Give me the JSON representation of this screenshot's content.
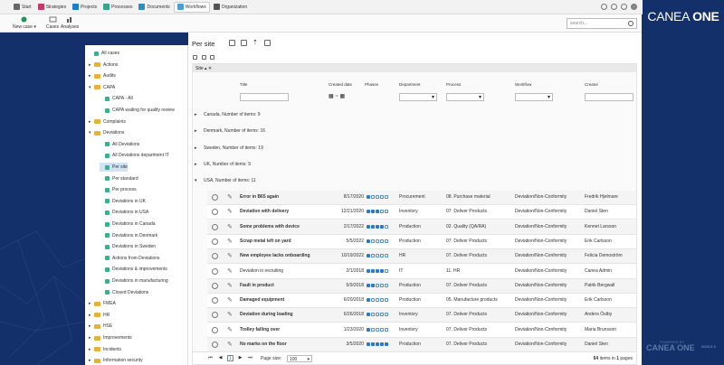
{
  "topnav": {
    "tabs": [
      {
        "label": "Start",
        "color": "#666666"
      },
      {
        "label": "Strategies",
        "color": "#c0396b"
      },
      {
        "label": "Projects",
        "color": "#1c7fc9"
      },
      {
        "label": "Processes",
        "color": "#37a58c"
      },
      {
        "label": "Documents",
        "color": "#2d8fc0"
      },
      {
        "label": "Workflows",
        "color": "#4b9fd1"
      },
      {
        "label": "Organization",
        "color": "#555555"
      }
    ],
    "active": "Workflows"
  },
  "toolbar": {
    "new_case": "New case",
    "cases": "Cases",
    "analyses": "Analyses"
  },
  "search": {
    "placeholder": "search..."
  },
  "brand": {
    "text_a": "CANEA",
    "text_b": "ONE"
  },
  "sidebar": {
    "items": [
      {
        "label": "All cases",
        "type": "view",
        "level": 1,
        "arrow": ""
      },
      {
        "label": "Actions",
        "type": "folder",
        "level": 1,
        "arrow": "▸"
      },
      {
        "label": "Audits",
        "type": "folder",
        "level": 1,
        "arrow": "▸"
      },
      {
        "label": "CAPA",
        "type": "folder",
        "level": 1,
        "arrow": "▾"
      },
      {
        "label": "CAPA - All",
        "type": "view",
        "level": 2,
        "arrow": ""
      },
      {
        "label": "CAPA waiting for quality review",
        "type": "view",
        "level": 2,
        "arrow": ""
      },
      {
        "label": "Complaints",
        "type": "folder",
        "level": 1,
        "arrow": "▸"
      },
      {
        "label": "Deviations",
        "type": "folder",
        "level": 1,
        "arrow": "▾"
      },
      {
        "label": "All Deviations",
        "type": "view",
        "level": 2,
        "arrow": ""
      },
      {
        "label": "All Deviations department IT",
        "type": "view",
        "level": 2,
        "arrow": ""
      },
      {
        "label": "Per site",
        "type": "view",
        "level": 2,
        "arrow": "",
        "selected": true
      },
      {
        "label": "Per standard",
        "type": "view",
        "level": 2,
        "arrow": ""
      },
      {
        "label": "Per process",
        "type": "view",
        "level": 2,
        "arrow": ""
      },
      {
        "label": "Deviations in UK",
        "type": "view",
        "level": 2,
        "arrow": ""
      },
      {
        "label": "Deviations in USA",
        "type": "view",
        "level": 2,
        "arrow": ""
      },
      {
        "label": "Deviations in Canada",
        "type": "view",
        "level": 2,
        "arrow": ""
      },
      {
        "label": "Deviations in Denmark",
        "type": "view",
        "level": 2,
        "arrow": ""
      },
      {
        "label": "Deviations in Sweden",
        "type": "view",
        "level": 2,
        "arrow": ""
      },
      {
        "label": "Actions from Deviations",
        "type": "view",
        "level": 2,
        "arrow": ""
      },
      {
        "label": "Deviations & improvements",
        "type": "view",
        "level": 2,
        "arrow": ""
      },
      {
        "label": "Deviations in manufacturing",
        "type": "view",
        "level": 2,
        "arrow": ""
      },
      {
        "label": "Closed Deviations",
        "type": "view",
        "level": 2,
        "arrow": ""
      },
      {
        "label": "FMEA",
        "type": "folder",
        "level": 1,
        "arrow": "▸"
      },
      {
        "label": "HR",
        "type": "folder",
        "level": 1,
        "arrow": "▸"
      },
      {
        "label": "HSE",
        "type": "folder",
        "level": 1,
        "arrow": "▸"
      },
      {
        "label": "Improvements",
        "type": "folder",
        "level": 1,
        "arrow": "▸"
      },
      {
        "label": "Incidents",
        "type": "folder",
        "level": 1,
        "arrow": "▸"
      },
      {
        "label": "Information security",
        "type": "folder",
        "level": 1,
        "arrow": "▸"
      }
    ]
  },
  "page": {
    "title": "Per site",
    "group_by": "Site"
  },
  "columns": {
    "title": "Title",
    "created": "Created date",
    "phases": "Phases",
    "department": "Department",
    "process": "Process",
    "workflow": "Workflow",
    "creator": "Creator"
  },
  "groups": [
    {
      "label": "Canada, Number of items: 9",
      "expanded": false
    },
    {
      "label": "Denmark, Number of items: 16",
      "expanded": false
    },
    {
      "label": "Sweden, Number of items: 19",
      "expanded": false
    },
    {
      "label": "UK, Number of items: 9",
      "expanded": false
    },
    {
      "label": "USA, Number of items: 11",
      "expanded": true
    }
  ],
  "rows": [
    {
      "title": "Error in B65 again",
      "bold": true,
      "date": "8/17/2020",
      "phase": 1,
      "dept": "Procurement",
      "process": "08. Purchase material",
      "workflow": "Deviation/Non-Conformity",
      "creator": "Fredrik Hjelmare"
    },
    {
      "title": "Deviation with delivery",
      "bold": true,
      "date": "12/21/2020",
      "phase": 3,
      "dept": "Inventory",
      "process": "07. Deliver Products",
      "workflow": "Deviation/Non-Conformity",
      "creator": "Daniel Sten"
    },
    {
      "title": "Some problems with device",
      "bold": true,
      "date": "2/17/2022",
      "phase": 4,
      "dept": "Production",
      "process": "02. Quality (QA/RA)",
      "workflow": "Deviation/Non-Conformity",
      "creator": "Kennet Larsson"
    },
    {
      "title": "Scrap metal left on yard",
      "bold": true,
      "date": "5/5/2022",
      "phase": 1,
      "dept": "Production",
      "process": "07. Deliver Products",
      "workflow": "Deviation/Non-Conformity",
      "creator": "Erik Carlsson"
    },
    {
      "title": "New employee lacks onboarding",
      "bold": true,
      "date": "10/19/2022",
      "phase": 1,
      "dept": "HR",
      "process": "07. Deliver Products",
      "workflow": "Deviation/Non-Conformity",
      "creator": "Felicia Demoström"
    },
    {
      "title": "Deviation in recruiting",
      "bold": false,
      "date": "2/1/2018",
      "phase": 4,
      "dept": "IT",
      "process": "11. HR",
      "workflow": "Deviation/Non-Conformity",
      "creator": "Canea Admin"
    },
    {
      "title": "Fault in product",
      "bold": true,
      "date": "5/9/2018",
      "phase": 2,
      "dept": "Production",
      "process": "07. Deliver Products",
      "workflow": "Deviation/Non-Conformity",
      "creator": "Patrik Bergwall"
    },
    {
      "title": "Damaged equipment",
      "bold": true,
      "date": "6/20/2018",
      "phase": 1,
      "dept": "Production",
      "process": "05. Manufacture products",
      "workflow": "Deviation/Non-Conformity",
      "creator": "Erik Carlsson"
    },
    {
      "title": "Deviation during loading",
      "bold": true,
      "date": "6/26/2018",
      "phase": 1,
      "dept": "Inventory",
      "process": "07. Deliver Products",
      "workflow": "Deviation/Non-Conformity",
      "creator": "Anders Östby"
    },
    {
      "title": "Trolley falling over",
      "bold": true,
      "date": "1/23/2020",
      "phase": 1,
      "dept": "Inventory",
      "process": "07. Deliver Products",
      "workflow": "Deviation/Non-Conformity",
      "creator": "Maria Brunsson"
    },
    {
      "title": "No marks on the floor",
      "bold": true,
      "date": "3/5/2020",
      "phase": 5,
      "dept": "Production",
      "process": "07. Deliver Products",
      "workflow": "Deviation/Non-Conformity",
      "creator": "Daniel Sten"
    }
  ],
  "pager": {
    "page": "1",
    "page_size_label": "Page size:",
    "page_size": "100",
    "summary_count": "64",
    "summary_mid": "items in",
    "summary_pages": "1",
    "summary_end": "pages"
  },
  "footer": {
    "powered": "CANEA ONE",
    "version": "2023.3.3",
    "powered_by": "POWERED BY"
  }
}
